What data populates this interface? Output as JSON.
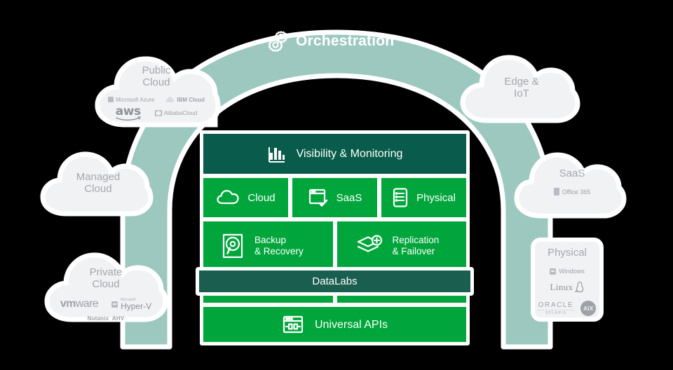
{
  "colors": {
    "arch": "#9cc8c0",
    "bright_green": "#00a63c",
    "dark_green": "#095c4b",
    "datalabs_green": "#1a5e50",
    "cloud_fill": "#f1f2f4",
    "cloud_text": "#a3a7ad",
    "background": "#000000"
  },
  "arch": {
    "label": "Orchestration",
    "icon": "gears-icon"
  },
  "clouds": {
    "public": {
      "title_line1": "Public",
      "title_line2": "Cloud",
      "logos": [
        "Microsoft Azure",
        "IBM Cloud",
        "aws",
        "AlibabaCloud"
      ]
    },
    "managed": {
      "title_line1": "Managed",
      "title_line2": "Cloud",
      "logos": []
    },
    "private": {
      "title_line1": "Private",
      "title_line2": "Cloud",
      "logos": [
        "vmware",
        "Microsoft Hyper-V",
        "Nutanix AHV"
      ],
      "vmware_vm": "vm",
      "vmware_ware": "ware",
      "hyperv_ms": "Microsoft",
      "hyperv_name": "Hyper-V",
      "nutanix": "Nutanix  AHV"
    },
    "edge": {
      "title_line1": "Edge &",
      "title_line2": "IoT",
      "logos": []
    },
    "saas": {
      "title_line1": "SaaS",
      "title_line2": "",
      "logos": [
        "Office 365"
      ],
      "office": "Office 365"
    }
  },
  "physical_box": {
    "title": "Physical",
    "windows": "Windows",
    "linux": "Linux",
    "oracle": "ORACLE",
    "solaris": "SOLARIS",
    "aix": "AIX"
  },
  "stack": {
    "visibility": {
      "label": "Visibility  & Monitoring",
      "icon": "bar-chart-icon"
    },
    "workloads": [
      {
        "label": "Cloud",
        "icon": "cloud-icon"
      },
      {
        "label": "SaaS",
        "icon": "browser-check-icon"
      },
      {
        "label": "Physical",
        "icon": "server-list-icon"
      }
    ],
    "protection": [
      {
        "label_line1": "Backup",
        "label_line2": "& Recovery",
        "icon": "disk-search-icon"
      },
      {
        "label_line1": "Replication",
        "label_line2": "& Failover",
        "icon": "layers-plus-icon"
      }
    ],
    "datalabs": {
      "label": "DataLabs"
    },
    "apis": {
      "label": "Universal APIs",
      "icon": "api-plug-icon"
    }
  }
}
